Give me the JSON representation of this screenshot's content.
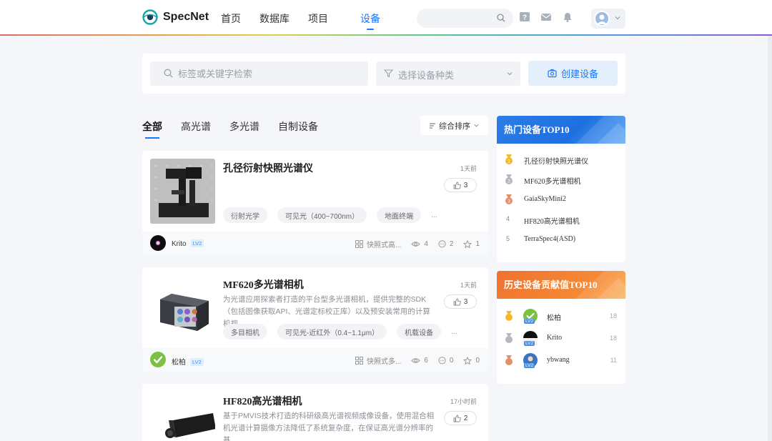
{
  "header": {
    "logo_text": "SpecNet",
    "nav": [
      "首页",
      "数据库",
      "项目",
      "设备"
    ],
    "active_nav": 3,
    "search_value": ""
  },
  "filters": {
    "keyword_placeholder": "标签或关键字检索",
    "type_placeholder": "选择设备种类",
    "create_label": "创建设备"
  },
  "tabs": [
    "全部",
    "高光谱",
    "多光谱",
    "自制设备"
  ],
  "sort_label": "综合排序",
  "devices": [
    {
      "title": "孔径衍射快照光谱仪",
      "time": "1天前",
      "likes": "3",
      "desc": "",
      "tags": [
        "衍射光学",
        "可见光（400~700nm）",
        "地面终端"
      ],
      "more": "...",
      "user": "Krito",
      "level": "LV2",
      "category": "快照式高...",
      "views": "4",
      "comments": "2",
      "stars": "1"
    },
    {
      "title": "MF620多光谱相机",
      "time": "1天前",
      "likes": "3",
      "desc": "为光谱应用探索者打造的平台型多光谱相机，提供完整的SDK（包括图像获取API、光谱定标校正库）以及预安装常用的计算机视...",
      "tags": [
        "多目相机",
        "可见光-近红外（0.4~1.1μm）",
        "机载设备"
      ],
      "more": "...",
      "user": "松柏",
      "level": "LV2",
      "category": "快照式多...",
      "views": "6",
      "comments": "0",
      "stars": "0"
    },
    {
      "title": "HF820高光谱相机",
      "time": "17小时前",
      "likes": "2",
      "desc": "基于PMVIS技术打造的科研级高光谱视频成像设备，使用混合相机光谱计算摄像方法降低了系统复杂度，在保证高光谱分辨率的基...",
      "tags": [],
      "more": "",
      "user": "",
      "level": "",
      "category": "",
      "views": "",
      "comments": "",
      "stars": ""
    }
  ],
  "hot": {
    "title": "热门设备TOP10",
    "items": [
      {
        "rank": "1",
        "name": "孔径衍射快照光谱仪"
      },
      {
        "rank": "2",
        "name": "MF620多光谱相机"
      },
      {
        "rank": "3",
        "name": "GaiaSkyMini2"
      },
      {
        "rank": "4",
        "name": "HF820高光谱相机"
      },
      {
        "rank": "5",
        "name": "TerraSpec4(ASD)"
      }
    ]
  },
  "history": {
    "title": "历史设备贡献值TOP10",
    "items": [
      {
        "name": "松柏",
        "score": "18",
        "level": "LV2"
      },
      {
        "name": "Krito",
        "score": "18",
        "level": "LV2"
      },
      {
        "name": "ybwang",
        "score": "11",
        "level": "LV2"
      }
    ]
  },
  "colors": {
    "accent": "#1677ff",
    "hot_header": "#2b7de8",
    "history_header": "#f58a35",
    "gold": "#f5b82e",
    "silver": "#b5b8bd",
    "bronze": "#e3906a"
  }
}
